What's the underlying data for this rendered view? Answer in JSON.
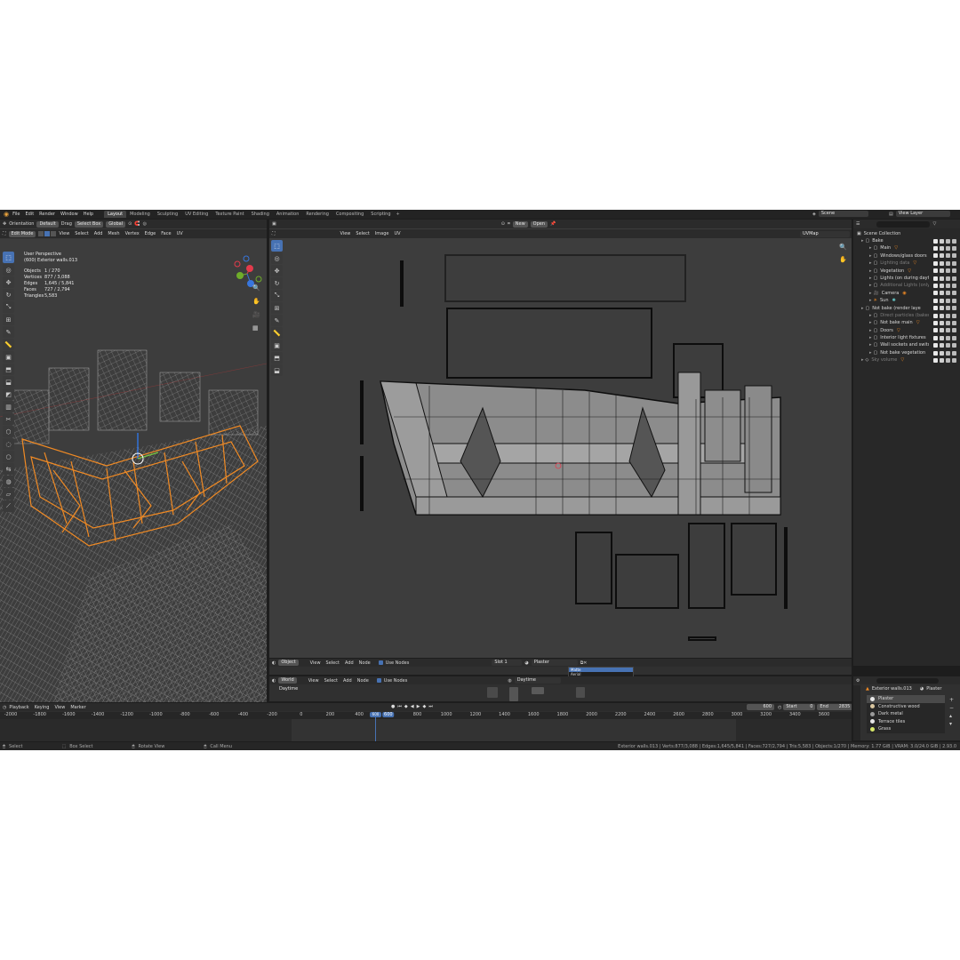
{
  "colors": {
    "selection_orange": "#f08a24",
    "accent_blue": "#4772b3",
    "panel_bg": "#303030",
    "uv_bg": "#3d3d3d",
    "header_bg": "#2b2b2b"
  },
  "topbar": {
    "menus": [
      "File",
      "Edit",
      "Render",
      "Window",
      "Help"
    ],
    "workspaces": [
      "Layout",
      "Modeling",
      "Sculpting",
      "UV Editing",
      "Texture Paint",
      "Shading",
      "Animation",
      "Rendering",
      "Compositing",
      "Scripting"
    ],
    "active_workspace": "Layout",
    "add_workspace": "+",
    "scene_label": "Scene",
    "view_layer_label": "View Layer"
  },
  "viewport": {
    "header": {
      "orientation_label": "Orientation",
      "orientation_value": "Default",
      "drag_label": "Drag",
      "drag_value": "Select Box",
      "transform_value": "Global"
    },
    "mode": "Edit Mode",
    "menus": [
      "View",
      "Select",
      "Add",
      "Mesh",
      "Vertex",
      "Edge",
      "Face",
      "UV"
    ],
    "overlay_title": "User Perspective",
    "overlay_object": "(600) Exterior walls.013",
    "stats": [
      {
        "label": "Objects",
        "value": "1 / 270"
      },
      {
        "label": "Vertices",
        "value": "877 / 3,088"
      },
      {
        "label": "Edges",
        "value": "1,645 / 5,841"
      },
      {
        "label": "Faces",
        "value": "727 / 2,794"
      },
      {
        "label": "Triangles",
        "value": "5,583"
      }
    ],
    "tools": [
      "select-box",
      "cursor",
      "move",
      "rotate",
      "scale",
      "transform",
      "annotate",
      "measure",
      "add-cube",
      "extrude",
      "inset",
      "bevel",
      "loop-cut",
      "knife",
      "poly-build",
      "spin",
      "smooth",
      "edge-slide",
      "shrink-fatten",
      "shear",
      "rip"
    ]
  },
  "uv_editor": {
    "header": {
      "new_label": "New",
      "open_label": "Open"
    },
    "menus": [
      "View",
      "Select",
      "Image",
      "UV"
    ],
    "uvmap": "UVMap",
    "tools": [
      "select",
      "cursor",
      "move",
      "rotate",
      "scale",
      "transform",
      "annotate",
      "box",
      "grab",
      "relax",
      "pinch"
    ]
  },
  "shader_editor": {
    "type_value": "Object",
    "menus": [
      "View",
      "Select",
      "Add",
      "Node"
    ],
    "use_nodes_label": "Use Nodes",
    "slot_label": "Slot 1",
    "material_name": "Plaster",
    "dropdown_items": [
      "Matte",
      "Aerial"
    ]
  },
  "world_editor": {
    "type_value": "World",
    "menus": [
      "View",
      "Select",
      "Add",
      "Node"
    ],
    "use_nodes_label": "Use Nodes",
    "world_name": "Daytime",
    "breadcrumb": "Daytime"
  },
  "outliner": {
    "title": "Scene Collection",
    "items": [
      {
        "label": "Bake",
        "indent": 1,
        "icon": "collection",
        "dim": false
      },
      {
        "label": "Main",
        "indent": 2,
        "icon": "collection",
        "dim": false,
        "badge": "filter"
      },
      {
        "label": "Windows/glass doors",
        "indent": 2,
        "icon": "collection",
        "dim": false
      },
      {
        "label": "Lighting data",
        "indent": 2,
        "icon": "collection",
        "dim": true,
        "badge": "filter"
      },
      {
        "label": "Vegetation",
        "indent": 2,
        "icon": "collection",
        "dim": false,
        "badge": "filter"
      },
      {
        "label": "Lights (on during dayti",
        "indent": 2,
        "icon": "collection",
        "dim": false
      },
      {
        "label": "Additional Lights (only",
        "indent": 2,
        "icon": "collection",
        "dim": true
      },
      {
        "label": "Camera",
        "indent": 2,
        "icon": "camera",
        "dim": false,
        "badge": "camera"
      },
      {
        "label": "Sun",
        "indent": 2,
        "icon": "light",
        "dim": false,
        "badge": "light"
      },
      {
        "label": "Not bake (render layer off b",
        "indent": 1,
        "icon": "collection",
        "dim": false
      },
      {
        "label": "Direct particles (baked",
        "indent": 2,
        "icon": "collection",
        "dim": true
      },
      {
        "label": "Not bake main",
        "indent": 2,
        "icon": "collection",
        "dim": false,
        "badge": "filter"
      },
      {
        "label": "Doors",
        "indent": 2,
        "icon": "collection",
        "dim": false,
        "badge": "filter"
      },
      {
        "label": "Interior light fixtures",
        "indent": 2,
        "icon": "collection",
        "dim": false
      },
      {
        "label": "Wall sockets and switch",
        "indent": 2,
        "icon": "collection",
        "dim": false
      },
      {
        "label": "Not bake vegetation",
        "indent": 2,
        "icon": "collection",
        "dim": false
      },
      {
        "label": "Sky volume",
        "indent": 1,
        "icon": "object",
        "dim": true,
        "badge": "filter"
      }
    ]
  },
  "properties": {
    "object_name": "Exterior walls.013",
    "material_name": "Plaster",
    "materials": [
      {
        "name": "Plaster",
        "color": "#e9e9e9",
        "active": true
      },
      {
        "name": "Constructive wood",
        "color": "#d9c6a0",
        "active": false
      },
      {
        "name": "Dark metal",
        "color": "#9a9a9a",
        "active": false
      },
      {
        "name": "Terrace tiles",
        "color": "#e6e6e6",
        "active": false
      },
      {
        "name": "Grass",
        "color": "#d8e86a",
        "active": false
      }
    ]
  },
  "timeline": {
    "menus": [
      "Playback",
      "Keying",
      "View",
      "Marker"
    ],
    "current_frame": "600",
    "start_label": "Start",
    "start_value": "0",
    "end_label": "End",
    "end_value": "2835",
    "ticks": [
      "-2000",
      "-1800",
      "-1600",
      "-1400",
      "-1200",
      "-1000",
      "-800",
      "-600",
      "-400",
      "-200",
      "0",
      "200",
      "400",
      "600",
      "800",
      "1000",
      "1200",
      "1400",
      "1600",
      "1800",
      "2000",
      "2200",
      "2400",
      "2600",
      "2800",
      "3000",
      "3200",
      "3400",
      "3600"
    ]
  },
  "statusbar": {
    "hints": [
      "Select",
      "Box Select",
      "Rotate View",
      "Call Menu"
    ],
    "info": "Exterior walls.013 | Verts:877/3,088 | Edges:1,645/5,841 | Faces:727/2,794 | Tris:5,583 | Objects:1/270 | Memory: 1.77 GiB | VRAM: 3.0/24.0 GiB | 2.93.0"
  }
}
